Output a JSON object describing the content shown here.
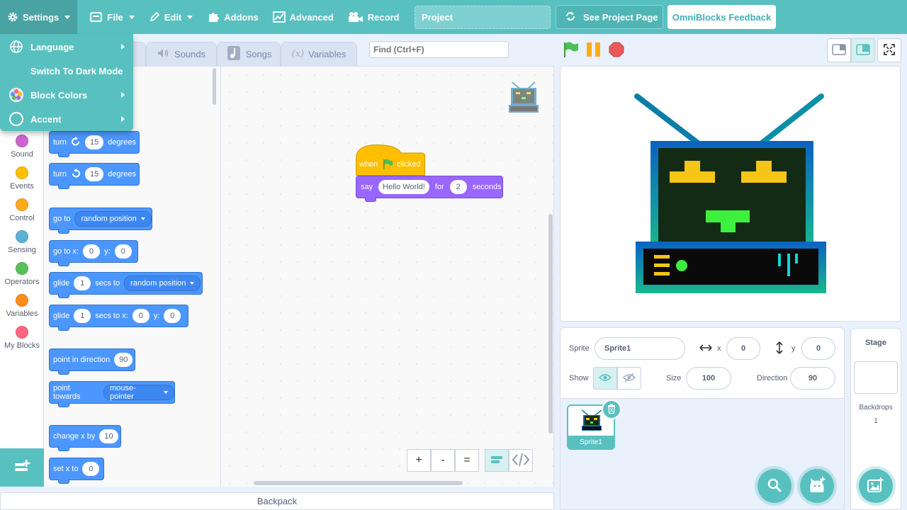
{
  "menubar": {
    "settings": "Settings",
    "file": "File",
    "edit": "Edit",
    "addons": "Addons",
    "advanced": "Advanced",
    "record": "Record",
    "project_title": "Project",
    "see_project_page": "See Project Page",
    "feedback": "OmniBlocks Feedback"
  },
  "settings_menu": {
    "items": [
      {
        "label": "Language",
        "icon": "globe-icon",
        "submenu": true
      },
      {
        "label": "Switch To Dark Mode",
        "icon": "moon-icon",
        "submenu": false
      },
      {
        "label": "Block Colors",
        "icon": "palette-icon",
        "submenu": true
      },
      {
        "label": "Accent",
        "icon": "circle-icon",
        "submenu": true
      }
    ]
  },
  "tabs": {
    "sounds": "Sounds",
    "songs": "Songs",
    "variables": "Variables"
  },
  "find": {
    "placeholder": "Find (Ctrl+F)"
  },
  "categories": [
    {
      "label": "Sound",
      "color": "#cf63cf"
    },
    {
      "label": "Events",
      "color": "#ffbf00"
    },
    {
      "label": "Control",
      "color": "#ffab19"
    },
    {
      "label": "Sensing",
      "color": "#5cb1d6"
    },
    {
      "label": "Operators",
      "color": "#59c059"
    },
    {
      "label": "Variables",
      "color": "#ff8c1a"
    },
    {
      "label": "My Blocks",
      "color": "#ff6680"
    }
  ],
  "palette": {
    "turn_right": {
      "prefix": "turn",
      "value": "15",
      "suffix": "degrees"
    },
    "turn_left": {
      "prefix": "turn",
      "value": "15",
      "suffix": "degrees"
    },
    "goto": {
      "prefix": "go to",
      "option": "random position"
    },
    "goto_xy": {
      "prefix": "go to x:",
      "x": "0",
      "ylabel": "y:",
      "y": "0"
    },
    "glide_to": {
      "prefix": "glide",
      "secs": "1",
      "mid": "secs to",
      "option": "random position"
    },
    "glide_xy": {
      "prefix": "glide",
      "secs": "1",
      "mid": "secs to x:",
      "x": "0",
      "ylabel": "y:",
      "y": "0"
    },
    "point_dir": {
      "prefix": "point in direction",
      "value": "90"
    },
    "point_towards": {
      "prefix": "point towards",
      "option": "mouse-pointer"
    },
    "change_x": {
      "prefix": "change x by",
      "value": "10"
    },
    "set_x": {
      "prefix": "set x to",
      "value": "0"
    }
  },
  "script": {
    "hat_when": "when",
    "hat_clicked": "clicked",
    "say": "say",
    "say_text": "Hello World!",
    "for": "for",
    "secs": "2",
    "seconds": "seconds"
  },
  "zoom": {
    "in": "+",
    "out": "-",
    "reset": "="
  },
  "backpack": "Backpack",
  "sprite_info": {
    "sprite_label": "Sprite",
    "sprite_name": "Sprite1",
    "x_label": "x",
    "x": "0",
    "y_label": "y",
    "y": "0",
    "show_label": "Show",
    "size_label": "Size",
    "size": "100",
    "direction_label": "Direction",
    "direction": "90"
  },
  "sprites": [
    {
      "name": "Sprite1"
    }
  ],
  "stage_pane": {
    "title": "Stage",
    "backdrops_label": "Backdrops",
    "backdrops_count": "1"
  },
  "colors": {
    "accent": "#59c0c0",
    "motion": "#4c97ff",
    "looks": "#9966ff",
    "events": "#ffbf00"
  }
}
